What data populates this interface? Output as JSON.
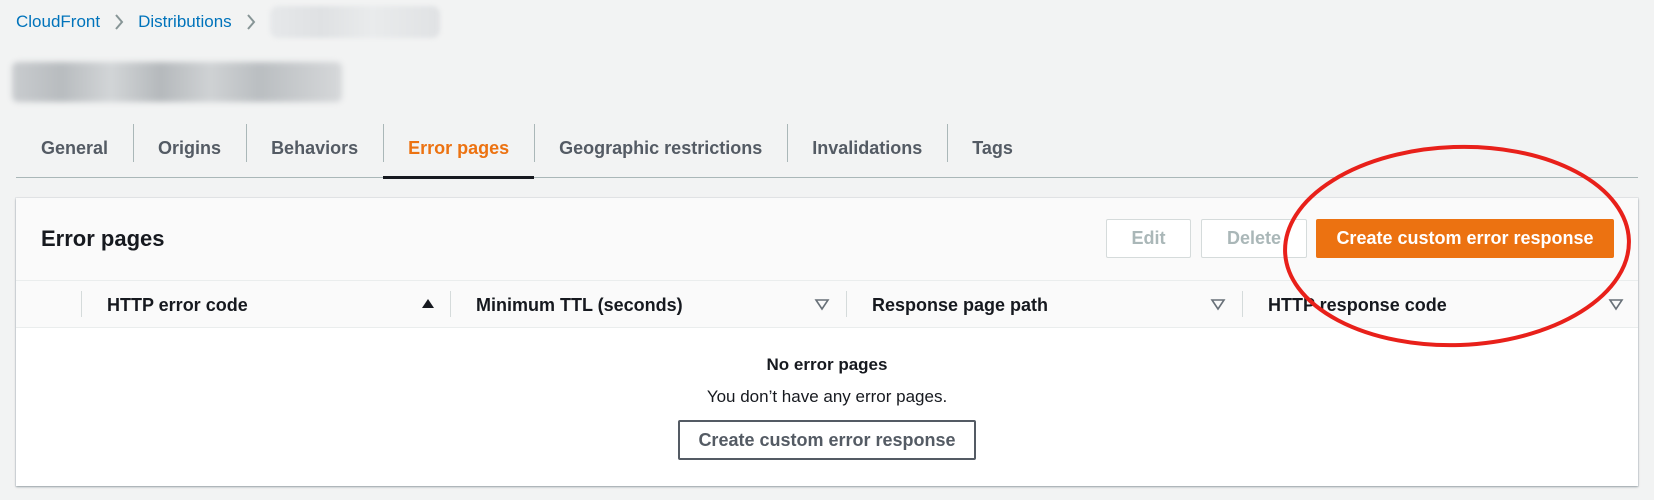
{
  "breadcrumb": {
    "items": [
      "CloudFront",
      "Distributions"
    ],
    "current_redacted": true
  },
  "page_title_redacted": true,
  "tabs": [
    {
      "label": "General",
      "active": false
    },
    {
      "label": "Origins",
      "active": false
    },
    {
      "label": "Behaviors",
      "active": false
    },
    {
      "label": "Error pages",
      "active": true
    },
    {
      "label": "Geographic restrictions",
      "active": false
    },
    {
      "label": "Invalidations",
      "active": false
    },
    {
      "label": "Tags",
      "active": false
    }
  ],
  "panel": {
    "title": "Error pages",
    "buttons": {
      "edit": "Edit",
      "delete": "Delete",
      "create": "Create custom error response"
    },
    "columns": [
      {
        "label": "HTTP error code",
        "sort": "ascending"
      },
      {
        "label": "Minimum TTL (seconds)",
        "sort": "none"
      },
      {
        "label": "Response page path",
        "sort": "none"
      },
      {
        "label": "HTTP response code",
        "sort": "none"
      }
    ],
    "empty": {
      "title": "No error pages",
      "description": "You don’t have any error pages.",
      "button": "Create custom error response"
    }
  },
  "colors": {
    "accent": "#ec7211",
    "link": "#0073bb",
    "annotation": "#e8201a"
  }
}
